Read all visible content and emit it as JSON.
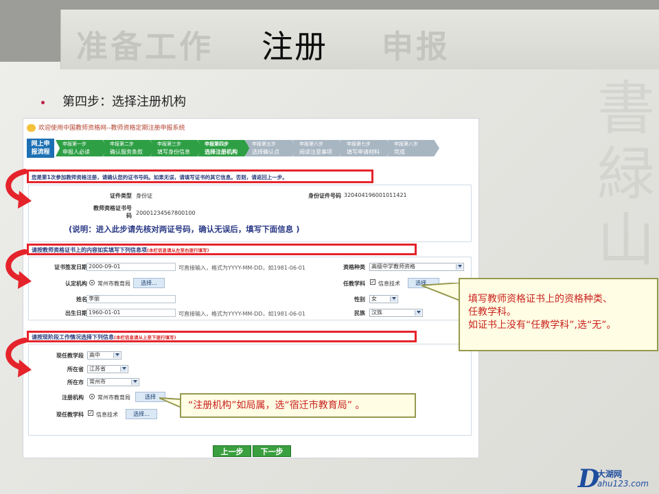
{
  "header": {
    "step1": "准备工作",
    "step2": "注册",
    "step3": "申报"
  },
  "bullet": "第四步：选择注册机构",
  "app": {
    "title": "欢迎使用中国教师资格网--教师资格定期注册申报系统",
    "process_first": [
      "网上申",
      "报流程"
    ],
    "steps": [
      {
        "top": "申报第一步",
        "bottom": "申报人必读",
        "state": "done"
      },
      {
        "top": "申报第二步",
        "bottom": "确认服务条款",
        "state": "done"
      },
      {
        "top": "申报第三步",
        "bottom": "填写身份信息",
        "state": "done"
      },
      {
        "top": "申报第四步",
        "bottom": "选择注册机构",
        "state": "cur"
      },
      {
        "top": "申报第五步",
        "bottom": "选择确认点",
        "state": "todo"
      },
      {
        "top": "申报第六步",
        "bottom": "阅读注意事项",
        "state": "todo"
      },
      {
        "top": "申报第七步",
        "bottom": "填写申请材料",
        "state": "todo"
      },
      {
        "top": "申报第八步",
        "bottom": "完成",
        "state": "todo"
      }
    ],
    "section1": {
      "banner": "您是第1次参加教师资格注册，请确认您的证书号码。如果无误，请填写证书的其它信息。否则，请返回上一步。",
      "cert_type_label": "证件类型",
      "cert_type_value": "身份证",
      "id_label": "身份证件号码",
      "id_value": "320404196001011421",
      "cert_no_label_a": "教师资格证书号",
      "cert_no_label_b": "码",
      "cert_no_value": "20001234567800100",
      "note": "(说明：进入此步请先核对两证号码，确认无误后，填写下面信息 )"
    },
    "section2": {
      "banner": "请按教师资格证书上的内容如实填写下列信息项",
      "banner_small": "(本栏信息请从左至右逐行填写)",
      "issue_date_label": "证书签发日期",
      "issue_date_value": "2000-09-01",
      "date_hint": "可直接输入，格式为YYYY-MM-DD，如1981-06-01",
      "qual_type_label": "资格种类",
      "qual_type_value": "高级中学教师资格",
      "org_label": "认定机构",
      "org_value": "常州市教育局",
      "select_btn": "选择...",
      "subject_label": "任教学科",
      "subject_value": "信息技术",
      "name_label": "姓名",
      "name_value": "李丽",
      "gender_label": "性别",
      "gender_value": "女",
      "birth_label": "出生日期",
      "birth_value": "1960-01-01",
      "birth_hint": "可直接输入，格式为YYYY-MM-DD，如1981-06-01",
      "ethnic_label": "民族",
      "ethnic_value": "汉族"
    },
    "section3": {
      "banner": "请按现阶段工作情况选择下列信息",
      "banner_small": "(本栏信息请从上至下逐行填写)",
      "stage_label": "现任教学段",
      "stage_value": "高中",
      "province_label": "所在省",
      "province_value": "江苏省",
      "city_label": "所在市",
      "city_value": "常州市",
      "reg_org_label": "注册机构",
      "reg_org_value": "常州市教育局",
      "reg_btn": "选择",
      "cur_subject_label": "现任教学科",
      "cur_subject_value": "信息技术",
      "select_btn": "选择..."
    },
    "prev_btn": "上一步",
    "next_btn": "下一步"
  },
  "callout_right": [
    "填写教师资格证书上的资格种类、",
    "任教学科。",
    "如证书上没有“任教学科”,选“无”。"
  ],
  "callout_bottom": "“注册机构”如局属，选“宿迁市教育局” 。",
  "logo": {
    "cn": "大湖网",
    "url": "ahu123.com",
    "d": "D"
  },
  "colors": {
    "green": "#2e9f45",
    "blue": "#1d70b4",
    "red": "#e5232b",
    "callout_border": "#95994e"
  }
}
